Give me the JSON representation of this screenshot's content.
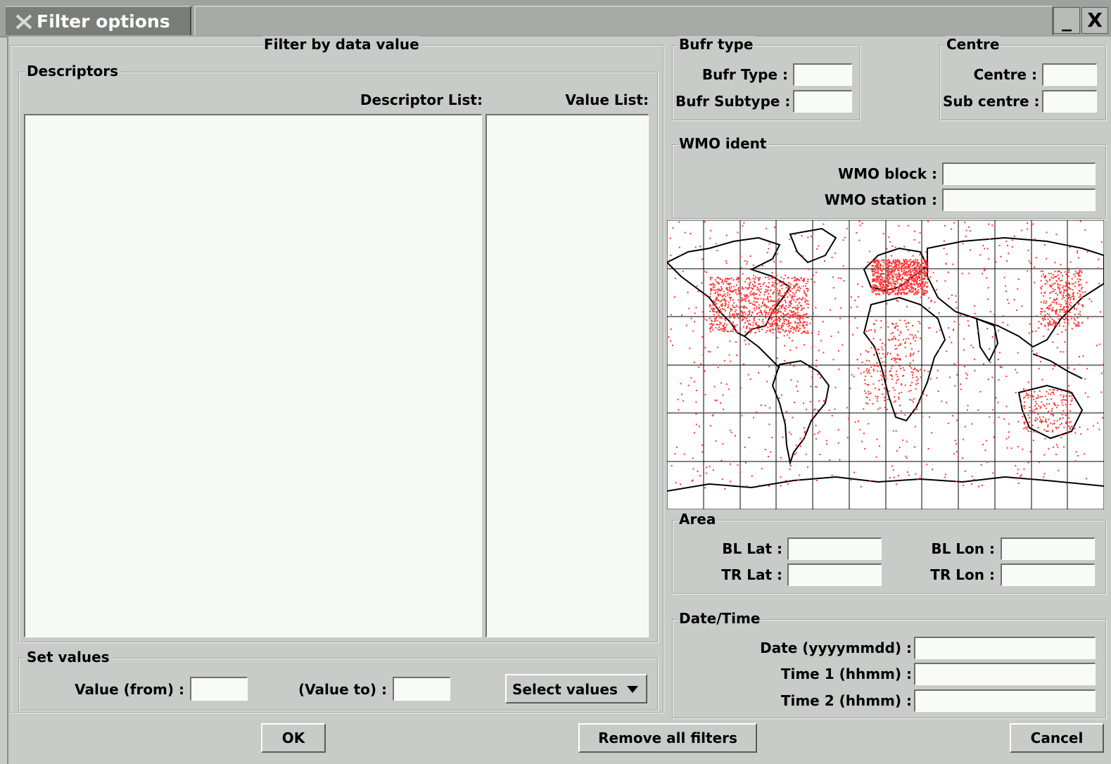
{
  "window": {
    "title": "Filter options",
    "minimize_label": "_",
    "close_label": "X"
  },
  "data_filter": {
    "group_title": "Filter by data value",
    "descriptors": {
      "group_title": "Descriptors",
      "descriptor_list_label": "Descriptor List:",
      "value_list_label": "Value List:",
      "descriptor_items": [],
      "value_items": []
    },
    "set_values": {
      "group_title": "Set values",
      "value_from_label": "Value (from) :",
      "value_from": "",
      "value_to_label": "(Value to) :",
      "value_to": "",
      "select_values_label": "Select values"
    }
  },
  "bufr_type": {
    "group_title": "Bufr type",
    "type_label": "Bufr Type :",
    "type_value": "",
    "subtype_label": "Bufr Subtype :",
    "subtype_value": ""
  },
  "centre": {
    "group_title": "Centre",
    "centre_label": "Centre :",
    "centre_value": "",
    "subcentre_label": "Sub centre :",
    "subcentre_value": ""
  },
  "wmo_ident": {
    "group_title": "WMO ident",
    "block_label": "WMO block :",
    "block_value": "",
    "station_label": "WMO station :",
    "station_value": ""
  },
  "map": {
    "land_color": "#000000",
    "points_color": "#ff3333",
    "grid_color": "#000000"
  },
  "area": {
    "group_title": "Area",
    "bl_lat_label": "BL Lat :",
    "bl_lat": "",
    "bl_lon_label": "BL Lon :",
    "bl_lon": "",
    "tr_lat_label": "TR Lat :",
    "tr_lat": "",
    "tr_lon_label": "TR Lon :",
    "tr_lon": ""
  },
  "datetime": {
    "group_title": "Date/Time",
    "date_label": "Date (yyyymmdd) :",
    "date_value": "",
    "time1_label": "Time 1 (hhmm) :",
    "time1_value": "",
    "time2_label": "Time 2 (hhmm) :",
    "time2_value": ""
  },
  "buttons": {
    "ok": "OK",
    "remove_all": "Remove all filters",
    "cancel": "Cancel"
  }
}
